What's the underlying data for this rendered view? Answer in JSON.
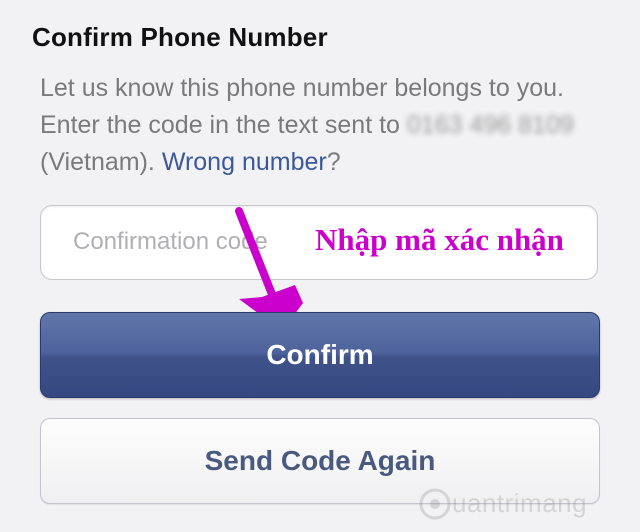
{
  "header": {
    "title": "Confirm Phone Number"
  },
  "description": {
    "text_before": "Let us know this phone number belongs to you. Enter the code in the text sent to ",
    "phone_part1": "0163",
    "phone_part2": "496 8109",
    "country": " (Vietnam). ",
    "wrong_link": "Wrong number",
    "suffix": "?"
  },
  "input": {
    "placeholder": "Confirmation code"
  },
  "annotation": {
    "text": "Nhập mã xác nhận",
    "color": "#cc00cc"
  },
  "buttons": {
    "confirm_label": "Confirm",
    "send_again_label": "Send Code Again"
  },
  "watermark": {
    "text": "uantrimang"
  },
  "colors": {
    "accent": "#3b5998",
    "confirm_bg": "#4d629a"
  }
}
